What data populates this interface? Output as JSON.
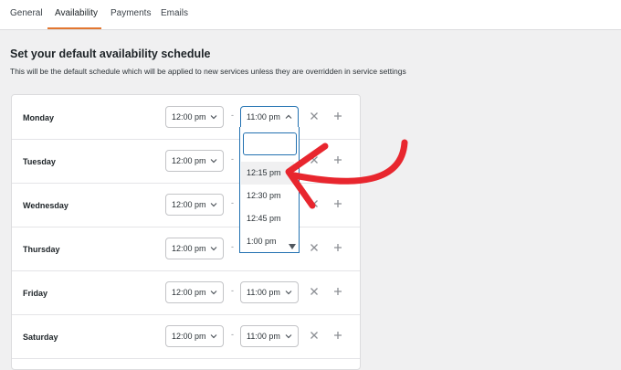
{
  "tabs": [
    {
      "label": "General"
    },
    {
      "label": "Availability",
      "active": true
    },
    {
      "label": "Payments"
    },
    {
      "label": "Emails"
    }
  ],
  "accent_color": "#e27730",
  "annotation_color": "#e8262e",
  "heading": "Set your default availability schedule",
  "subtext": "This will be the default schedule which will be applied to new services unless they are overridden in service settings",
  "dash": "-",
  "rows": [
    {
      "day": "Monday",
      "start": "12:00 pm",
      "end": "11:00 pm"
    },
    {
      "day": "Tuesday",
      "start": "12:00 pm",
      "end": ""
    },
    {
      "day": "Wednesday",
      "start": "12:00 pm",
      "end": ""
    },
    {
      "day": "Thursday",
      "start": "12:00 pm",
      "end": ""
    },
    {
      "day": "Friday",
      "start": "12:00 pm",
      "end": "11:00 pm"
    },
    {
      "day": "Saturday",
      "start": "12:00 pm",
      "end": "11:00 pm"
    }
  ],
  "dropdown": {
    "search_value": "",
    "options": [
      "12:15 pm",
      "12:30 pm",
      "12:45 pm",
      "1:00 pm"
    ],
    "highlighted": "12:15 pm"
  },
  "icons": {
    "remove": "close-icon",
    "add": "plus-icon",
    "select_closed": "chevron-down-icon",
    "select_open": "chevron-up-icon",
    "annotation": "red-arrow"
  }
}
